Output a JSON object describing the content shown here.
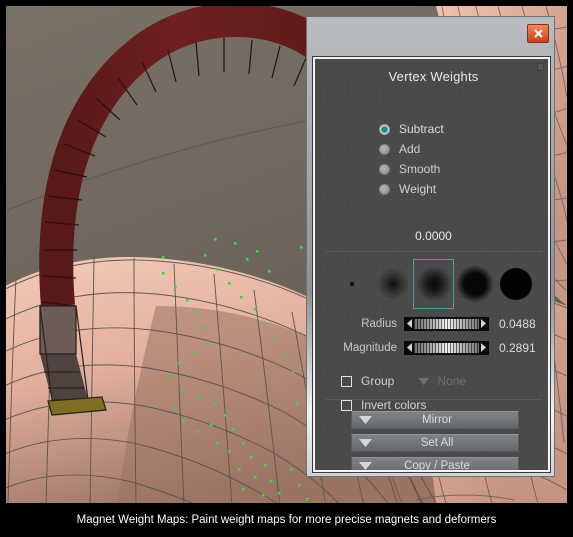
{
  "caption": "Magnet Weight Maps: Paint weight maps for more precise magnets and deformers",
  "panel": {
    "title": "Vertex Weights",
    "close_icon": "close-x-icon",
    "resize_icon": "resize-handle-icon",
    "modes": [
      {
        "label": "Subtract",
        "selected": true
      },
      {
        "label": "Add",
        "selected": false
      },
      {
        "label": "Smooth",
        "selected": false
      },
      {
        "label": "Weight",
        "selected": false
      }
    ],
    "weight_value": "0.0000",
    "brushes": [
      {
        "name": "brush-size-1-pixel",
        "selected": false
      },
      {
        "name": "brush-size-2-small-soft",
        "selected": false
      },
      {
        "name": "brush-size-3-medium-soft",
        "selected": true
      },
      {
        "name": "brush-size-4-large-soft",
        "selected": false
      },
      {
        "name": "brush-size-5-large-hard",
        "selected": false
      }
    ],
    "sliders": [
      {
        "label": "Radius",
        "value": "0.0488",
        "fraction": 0.0488
      },
      {
        "label": "Magnitude",
        "value": "0.2891",
        "fraction": 0.2891
      }
    ],
    "group": {
      "checkbox_label": "Group",
      "checked": false,
      "dropdown_value": "None",
      "dropdown_enabled": false,
      "caret_icon": "chevron-down-icon"
    },
    "invert": {
      "checkbox_label": "Invert colors",
      "checked": false
    },
    "actions": [
      {
        "label": "Mirror",
        "caret_icon": "chevron-down-icon"
      },
      {
        "label": "Set All",
        "caret_icon": "chevron-down-icon"
      },
      {
        "label": "Copy / Paste",
        "caret_icon": "chevron-down-icon"
      }
    ]
  },
  "viewport": {
    "description": "3D modeling viewport showing a dark red horseshoe magnet deformer above a pink wireframe mesh surface with green selected vertices",
    "background_color": "#6e665c",
    "magnet_color": "#6e2020",
    "magnet_tip_color": "#5a4a44",
    "magnet_pole_color": "#7a6a22",
    "mesh_color": "#e8b9a6",
    "wire_color": "#5c534c",
    "vertex_color": "#33dd33"
  }
}
